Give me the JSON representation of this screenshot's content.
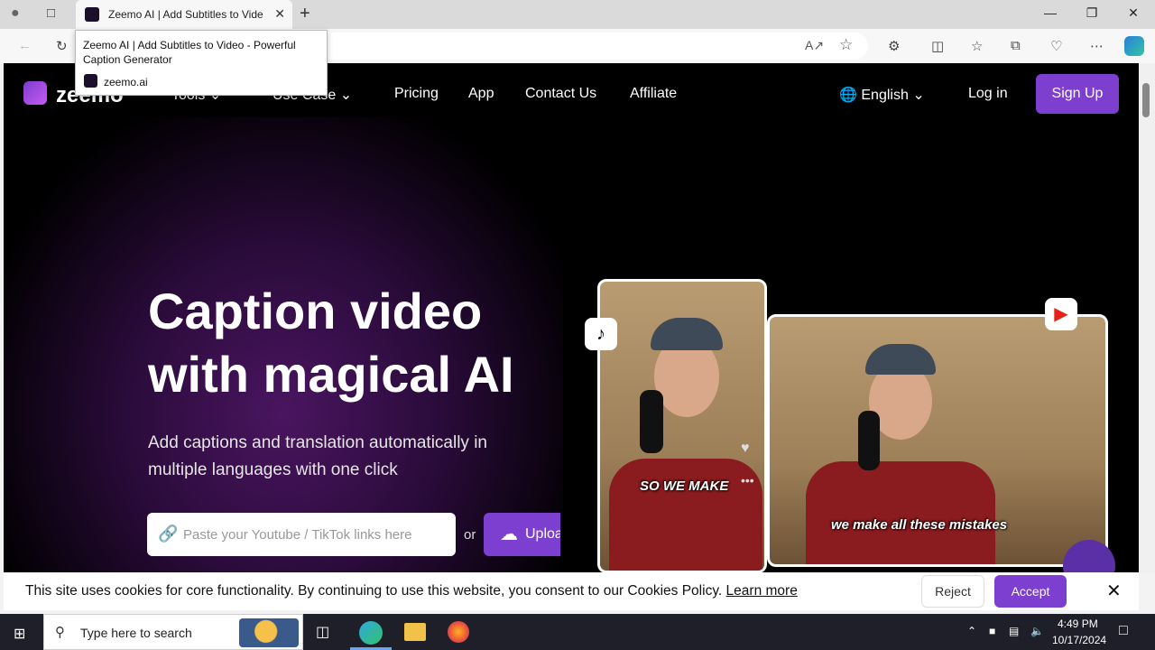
{
  "browser": {
    "tab_title": "Zeemo AI | Add Subtitles to Video - Powerful Caption Generator",
    "tab_title_short": "Zeemo AI | Add Subtitles to Vide",
    "tooltip_title": "Zeemo AI | Add Subtitles to Video - Powerful Caption Generator",
    "tooltip_domain": "zeemo.ai"
  },
  "nav": {
    "logo": "zeemo",
    "tools": "Tools",
    "use_case": "Use Case",
    "pricing": "Pricing",
    "app": "App",
    "contact": "Contact Us",
    "affiliate": "Affiliate",
    "language": "English",
    "login": "Log in",
    "signup": "Sign Up"
  },
  "hero": {
    "title": "Caption video with magical AI",
    "subtitle": "Add captions and translation automatically in multiple languages with one click",
    "link_placeholder": "Paste your Youtube / TikTok links here",
    "or": "or",
    "upload": "Upload"
  },
  "video": {
    "caption_left": "SO WE MAKE",
    "caption_right": "we make all these mistakes"
  },
  "cookie": {
    "text": "This site uses cookies for core functionality. By continuing to use this website, you consent to our Cookies Policy.",
    "learn_more": "Learn more",
    "reject": "Reject",
    "accept": "Accept"
  },
  "taskbar": {
    "search_placeholder": "Type here to search",
    "time": "4:49 PM",
    "date": "10/17/2024"
  },
  "colors": {
    "brand_purple": "#7c3fd0",
    "page_bg": "#000000"
  }
}
